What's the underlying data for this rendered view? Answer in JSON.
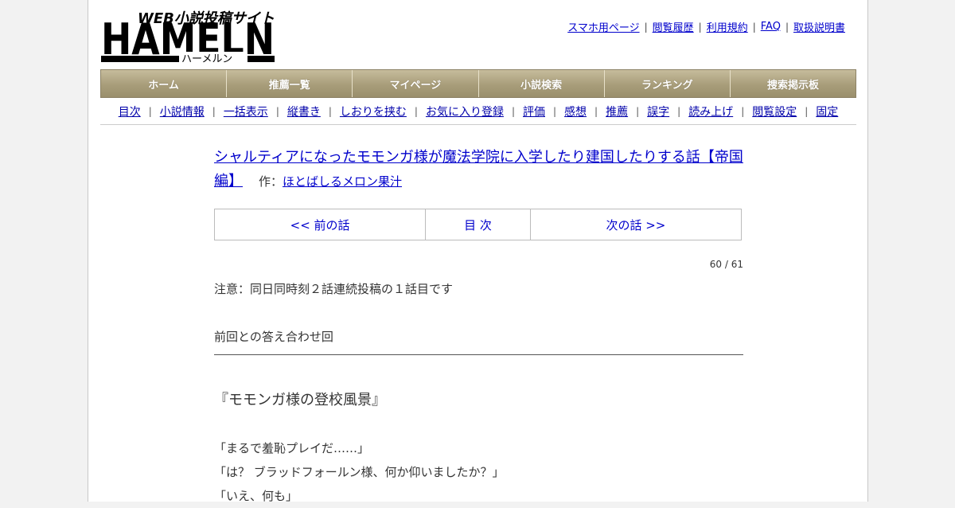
{
  "header": {
    "logo_tagline": "WEB小説投稿サイト",
    "logo_name": "HAMELN",
    "logo_kana": "ハーメルン",
    "links": [
      "スマホ用ページ",
      "閲覧履歴",
      "利用規約",
      "FAQ",
      "取扱説明書"
    ]
  },
  "nav": [
    "ホーム",
    "推薦一覧",
    "マイページ",
    "小説検索",
    "ランキング",
    "捜索掲示板"
  ],
  "subnav": [
    "目次",
    "小説情報",
    "一括表示",
    "縦書き",
    "しおりを挟む",
    "お気に入り登録",
    "評価",
    "感想",
    "推薦",
    "誤字",
    "読み上げ",
    "閲覧設定",
    "固定"
  ],
  "novel": {
    "title": "シャルティアになったモモンガ様が魔法学院に入学したり建国したりする話【帝国編】",
    "author_prefix": "作：",
    "author": "ほとばしるメロン果汁"
  },
  "pager": {
    "prev": "<< 前の話",
    "toc": "目 次",
    "next": "次の話 >>"
  },
  "chapter_count": "60 / 61",
  "notice": "注意：同日同時刻２話連続投稿の１話目です",
  "preface": "前回との答え合わせ回",
  "section_title": "『モモンガ様の登校風景』",
  "body": [
    "「まるで羞恥プレイだ……」",
    "「は？ ブラッドフォールン様、何か仰いましたか？」",
    "「いえ、何も」"
  ]
}
